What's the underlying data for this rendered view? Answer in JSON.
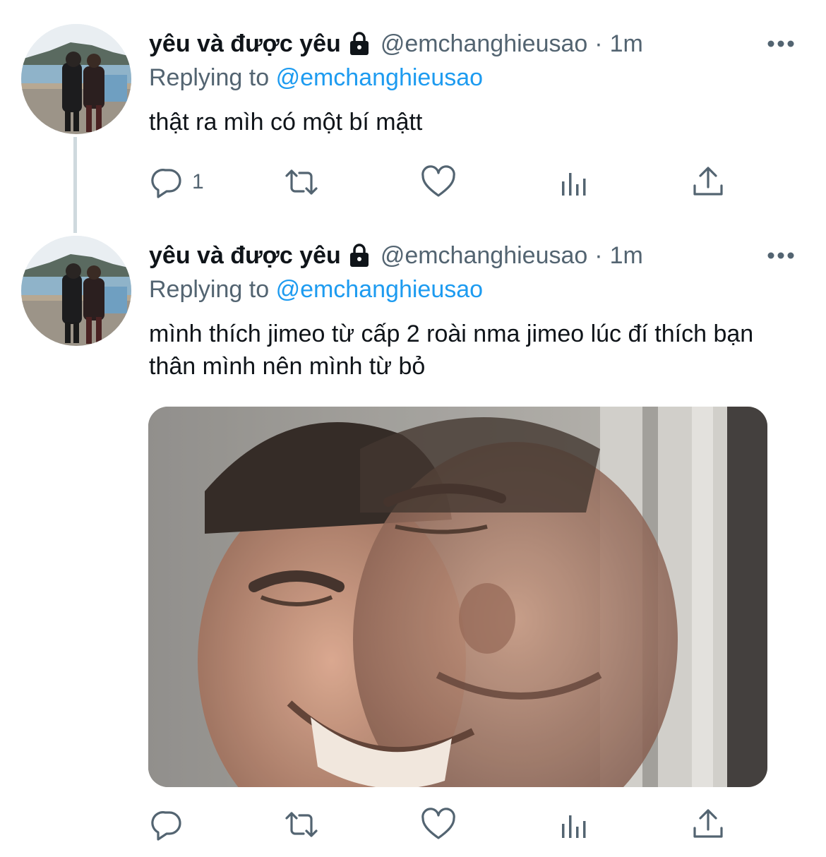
{
  "tweets": [
    {
      "display_name": "yêu và được yêu",
      "handle": "@emchanghieusao",
      "separator": "·",
      "time": "1m",
      "replying_prefix": "Replying to",
      "replying_to": "@emchanghieusao",
      "text": "thật ra mìh có một bí mậtt",
      "reply_count": "1",
      "protected": true
    },
    {
      "display_name": "yêu và được yêu",
      "handle": "@emchanghieusao",
      "separator": "·",
      "time": "1m",
      "replying_prefix": "Replying to",
      "replying_to": "@emchanghieusao",
      "text": "mình thích jimeo từ cấp 2 roài nma jimeo lúc đí thích bạn thân mình nên mình từ bỏ",
      "reply_count": "",
      "protected": true,
      "has_media": true
    }
  ],
  "icons": {
    "lock": "lock-icon",
    "more": "more-icon",
    "reply": "reply-icon",
    "retweet": "retweet-icon",
    "like": "heart-icon",
    "views": "analytics-icon",
    "share": "share-icon"
  },
  "colors": {
    "text": "#0f1419",
    "secondary": "#536471",
    "link": "#1d9bf0",
    "thread_line": "#cfd9de"
  }
}
